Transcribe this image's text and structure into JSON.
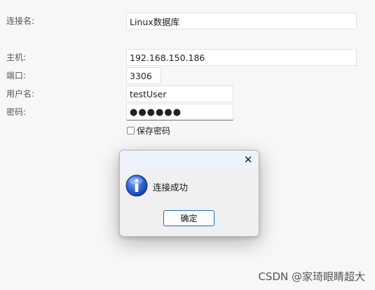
{
  "form": {
    "conn_name_label": "连接名:",
    "conn_name_value": "Linux数据库",
    "host_label": "主机:",
    "host_value": "192.168.150.186",
    "port_label": "端口:",
    "port_value": "3306",
    "user_label": "用户名:",
    "user_value": "testUser",
    "password_label": "密码:",
    "password_value": "●●●●●●",
    "save_password_label": "保存密码",
    "save_password_checked": false
  },
  "dialog": {
    "icon": "info-icon",
    "message": "连接成功",
    "ok_label": "确定",
    "close_icon": "close-icon"
  },
  "watermark": "CSDN @家琦眼睛超大",
  "colors": {
    "button_border": "#1a6fc4",
    "info_blue": "#1f4fb8",
    "titlebar": "#eef2fa"
  }
}
